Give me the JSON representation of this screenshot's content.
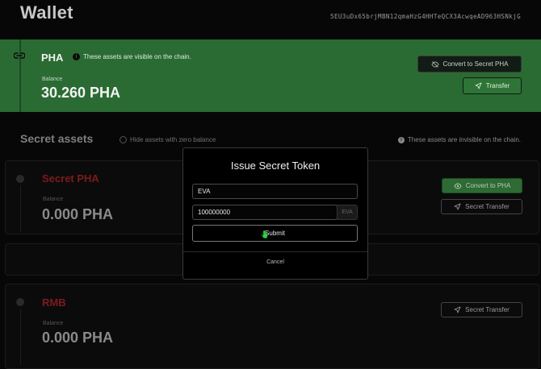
{
  "header": {
    "title": "Wallet",
    "address": "5EU3uDx65brjMBN12qmaHzG4HHTeQCX3AcwqeAD963HSNkjG"
  },
  "public_asset": {
    "name": "PHA",
    "note": "These assets are visible on the chain.",
    "balance_label": "Balance",
    "balance": "30.260 PHA",
    "convert_label": "Convert to Secret PHA",
    "transfer_label": "Transfer"
  },
  "secret_section": {
    "title": "Secret assets",
    "hide_zero_label": "Hide assets with zero balance",
    "invisible_note": "These assets are invisible on the chain."
  },
  "secret_assets": [
    {
      "name": "Secret PHA",
      "balance_label": "Balance",
      "balance": "0.000 PHA",
      "convert_label": "Convert to PHA",
      "transfer_label": "Secret Transfer"
    },
    {
      "name": "RMB",
      "balance_label": "Balance",
      "balance": "0.000 PHA",
      "transfer_label": "Secret Transfer"
    }
  ],
  "modal": {
    "title": "Issue Secret Token",
    "name_value": "EVA",
    "supply_value": "100000000",
    "symbol_addon": "EVA",
    "submit_label": "Submit",
    "cancel_label": "Cancel"
  },
  "colors": {
    "public_card": "#2a6b33",
    "secret_asset_name": "#7e1b1b"
  }
}
